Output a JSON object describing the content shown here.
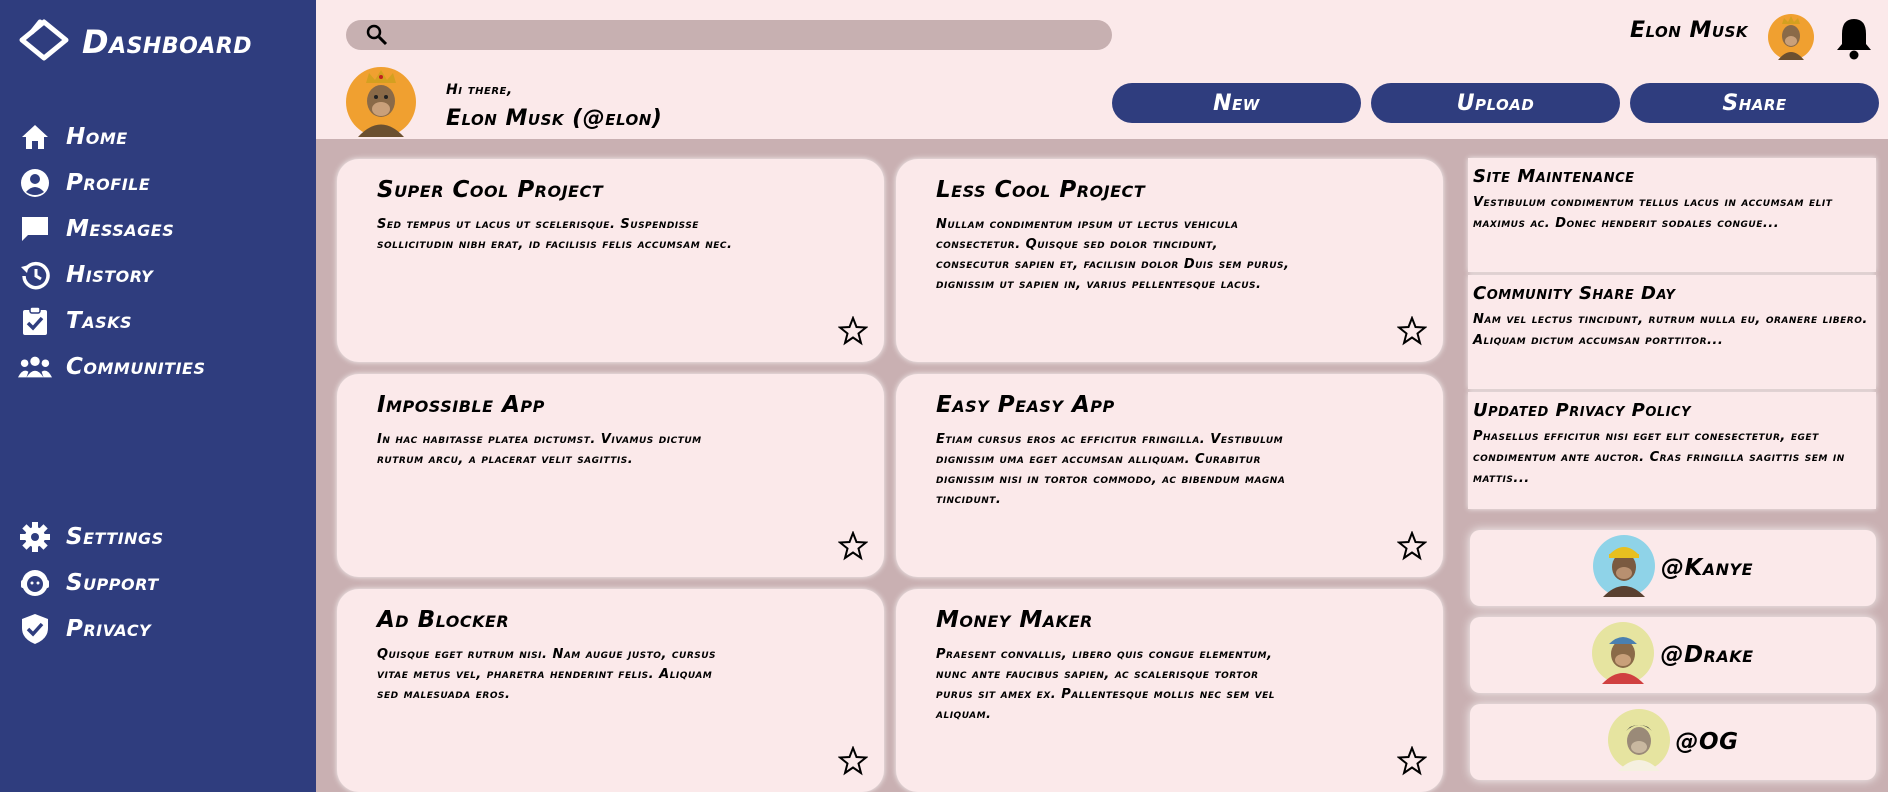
{
  "brand": {
    "title": "Dashboard",
    "icon": "diamond-logo-icon"
  },
  "sidebar": {
    "top_items": [
      {
        "label": "Home",
        "icon": "home-icon"
      },
      {
        "label": "Profile",
        "icon": "user-circle-icon"
      },
      {
        "label": "Messages",
        "icon": "message-icon"
      },
      {
        "label": "History",
        "icon": "history-icon"
      },
      {
        "label": "Tasks",
        "icon": "clipboard-check-icon"
      },
      {
        "label": "Communities",
        "icon": "people-icon"
      }
    ],
    "bottom_items": [
      {
        "label": "Settings",
        "icon": "gear-icon"
      },
      {
        "label": "Support",
        "icon": "support-icon"
      },
      {
        "label": "Privacy",
        "icon": "shield-check-icon"
      }
    ]
  },
  "header": {
    "search_placeholder": "",
    "user_name": "Elon Musk",
    "greeting": "Hi there,",
    "profile_name": "Elon Musk (@elon)",
    "actions": [
      "New",
      "Upload",
      "Share"
    ]
  },
  "projects": [
    {
      "title": "Super Cool Project",
      "description": "Sed tempus ut lacus ut scelerisque. Suspendisse sollicitudin nibh erat, id facilisis felis accumsam nec."
    },
    {
      "title": "Less Cool Project",
      "description": "Nullam condimentum ipsum ut lectus vehicula consectetur. Quisque sed dolor tincidunt, consecutur sapien et, facilisin dolor Duis sem purus, dignissim ut sapien in, varius pellentesque lacus."
    },
    {
      "title": "Impossible App",
      "description": "In hac habitasse platea dictumst. Vivamus dictum rutrum arcu, a placerat velit sagittis."
    },
    {
      "title": "Easy Peasy App",
      "description": "Etiam cursus eros ac efficitur fringilla. Vestibulum dignissim uma eget accumsan alliquam. Curabitur dignissim nisi in tortor commodo, ac bibendum magna tincidunt."
    },
    {
      "title": "Ad Blocker",
      "description": "Quisque eget rutrum nisi. Nam augue justo, cursus vitae metus vel, pharetra henderint felis. Aliquam sed malesuada eros."
    },
    {
      "title": "Money Maker",
      "description": "Praesent convallis, libero quis congue elementum, nunc ante faucibus sapien, ac scalerisque tortor purus sit amex ex. Pallentesque mollis nec sem vel aliquam."
    }
  ],
  "announcements": [
    {
      "title": "Site Maintenance",
      "text": "Vestibulum condimentum tellus lacus in accumsam elit maximus ac. Donec henderit sodales congue..."
    },
    {
      "title": "Community Share Day",
      "text": "Nam vel lectus tincidunt, rutrum nulla eu, oranere libero. Aliquam dictum accumsan porttitor..."
    },
    {
      "title": "Updated Privacy Policy",
      "text": "Phasellus efficitur nisi eget elit conesectetur, eget condimentum ante auctor. Cras fringilla sagittis sem in mattis..."
    }
  ],
  "trending": [
    {
      "handle": "@Kanye"
    },
    {
      "handle": "@Drake"
    },
    {
      "handle": "@OG"
    }
  ],
  "colors": {
    "navy": "#2f3d7e",
    "panel": "#fbe9ea",
    "backdrop": "#c9b0b2"
  }
}
